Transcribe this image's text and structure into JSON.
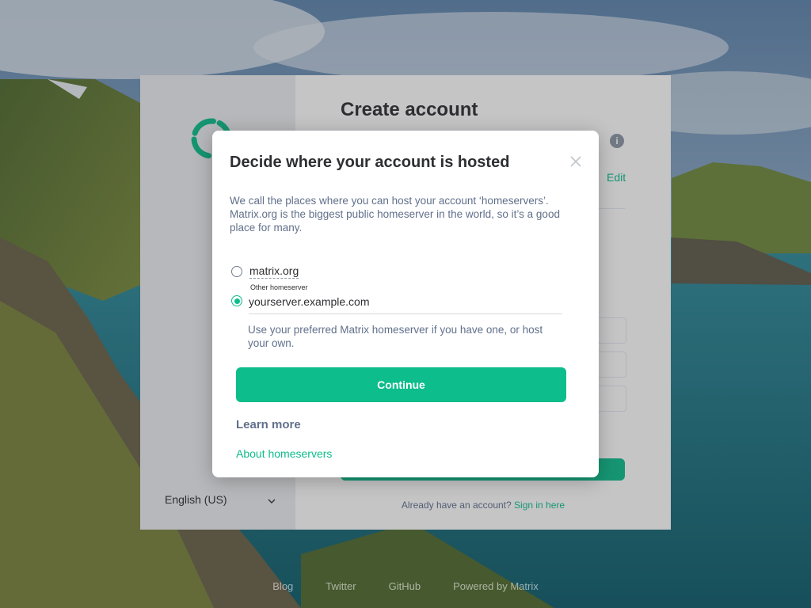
{
  "auth": {
    "title": "Create account",
    "info_icon_glyph": "i",
    "edit_label": "Edit",
    "language": "English (US)",
    "signin_prompt": "Already have an account?",
    "signin_link": "Sign in here"
  },
  "dialog": {
    "title": "Decide where your account is hosted",
    "close_icon": "close-icon",
    "description": "We call the places where you can host your account ‘homeservers’. Matrix.org is the biggest public homeserver in the world, so it’s a good place for many.",
    "option_matrix": "matrix.org",
    "other_label": "Other homeserver",
    "server_value": "yourserver.example.com",
    "server_hint": "Use your preferred Matrix homeserver if you have one, or host your own.",
    "continue_label": "Continue",
    "learn_more": "Learn more",
    "about_link": "About homeservers",
    "selected_option": "other"
  },
  "footer": {
    "blog": "Blog",
    "twitter": "Twitter",
    "github": "GitHub",
    "powered": "Powered by Matrix"
  },
  "colors": {
    "accent": "#0dbd8b",
    "text_primary": "#2e2f32",
    "text_secondary": "#61708b"
  }
}
